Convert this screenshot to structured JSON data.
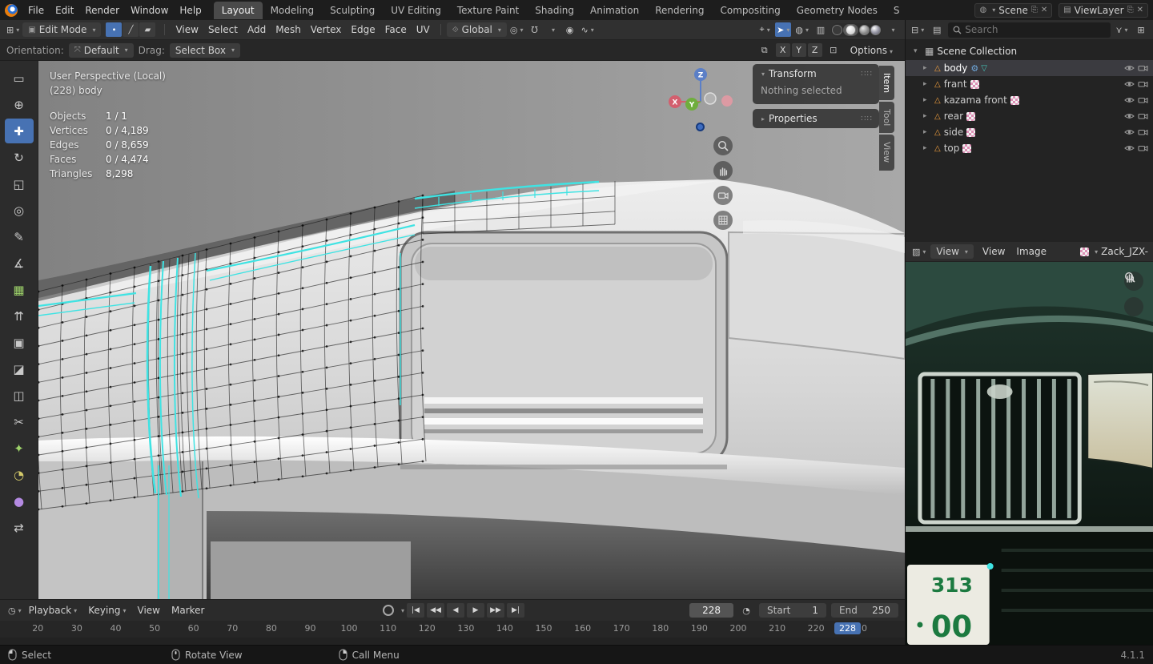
{
  "topbar": {
    "menus": [
      "File",
      "Edit",
      "Render",
      "Window",
      "Help"
    ],
    "tabs": [
      {
        "label": "Layout",
        "active": true
      },
      {
        "label": "Modeling"
      },
      {
        "label": "Sculpting"
      },
      {
        "label": "UV Editing"
      },
      {
        "label": "Texture Paint"
      },
      {
        "label": "Shading"
      },
      {
        "label": "Animation"
      },
      {
        "label": "Rendering"
      },
      {
        "label": "Compositing"
      },
      {
        "label": "Geometry Nodes"
      },
      {
        "label": "S"
      }
    ],
    "scene_name": "Scene",
    "view_layer_name": "ViewLayer"
  },
  "viewport_header": {
    "mode_label": "Edit Mode",
    "menus": [
      "View",
      "Select",
      "Add",
      "Mesh",
      "Vertex",
      "Edge",
      "Face",
      "UV"
    ],
    "orientation_label": "Global"
  },
  "tool_settings": {
    "orientation_label": "Orientation:",
    "orientation_value": "Default",
    "drag_label": "Drag:",
    "drag_value": "Select Box",
    "axis_toggles": [
      "X",
      "Y",
      "Z"
    ],
    "options_label": "Options"
  },
  "toolbar_tools": [
    {
      "name": "tool-select-box-button",
      "icon": "▭"
    },
    {
      "name": "tool-cursor-button",
      "icon": "⊕"
    },
    {
      "name": "tool-move-button",
      "icon": "✚",
      "active": true
    },
    {
      "name": "tool-rotate-button",
      "icon": "↻"
    },
    {
      "name": "tool-scale-button",
      "icon": "◱"
    },
    {
      "name": "tool-transform-button",
      "icon": "◎"
    },
    {
      "name": "tool-annotate-button",
      "icon": "✎"
    },
    {
      "name": "tool-measure-button",
      "icon": "∡"
    },
    {
      "name": "tool-add-cube-button",
      "icon": "▦",
      "color": "#9ed36a"
    },
    {
      "name": "tool-extrude-button",
      "icon": "⇈"
    },
    {
      "name": "tool-inset-faces-button",
      "icon": "▣"
    },
    {
      "name": "tool-bevel-button",
      "icon": "◪"
    },
    {
      "name": "tool-loop-cut-button",
      "icon": "◫"
    },
    {
      "name": "tool-knife-button",
      "icon": "✂"
    },
    {
      "name": "tool-poly-build-button",
      "icon": "✦",
      "color": "#9ed36a"
    },
    {
      "name": "tool-spin-button",
      "icon": "◔",
      "color": "#d3c96a"
    },
    {
      "name": "tool-smooth-button",
      "icon": "●",
      "color": "#b48ae2"
    },
    {
      "name": "tool-edge-slide-button",
      "icon": "⇄"
    }
  ],
  "viewport": {
    "view_label": "User Perspective (Local)",
    "object_label": "(228) body",
    "stats": [
      {
        "label": "Objects",
        "value": "1 / 1"
      },
      {
        "label": "Vertices",
        "value": "0 / 4,189"
      },
      {
        "label": "Edges",
        "value": "0 / 8,659"
      },
      {
        "label": "Faces",
        "value": "0 / 4,474"
      },
      {
        "label": "Triangles",
        "value": "8,298"
      }
    ],
    "gizmo": {
      "x": "X",
      "y": "Y",
      "z": "Z"
    }
  },
  "npanel": {
    "transform_title": "Transform",
    "empty_message": "Nothing selected",
    "properties_title": "Properties",
    "tabs": [
      {
        "label": "Item",
        "active": true
      },
      {
        "label": "Tool"
      },
      {
        "label": "View"
      }
    ]
  },
  "outliner": {
    "search_placeholder": "Search",
    "root_label": "Scene Collection",
    "items": [
      {
        "label": "body",
        "active": true,
        "kind": "mod"
      },
      {
        "label": "frant",
        "kind": "image"
      },
      {
        "label": "kazama front",
        "kind": "image"
      },
      {
        "label": "rear",
        "kind": "image"
      },
      {
        "label": "side",
        "kind": "image"
      },
      {
        "label": "top",
        "kind": "image"
      }
    ]
  },
  "image_editor": {
    "display_mode": "View",
    "menus": [
      "View",
      "Image"
    ],
    "image_name": "Zack_JZX-",
    "plate_top": "313",
    "plate_bottom": "00"
  },
  "timeline": {
    "popovers": [
      "Playback",
      "Keying"
    ],
    "menus": [
      "View",
      "Marker"
    ],
    "transport": [
      {
        "name": "jump-start-button",
        "icon": "|◀"
      },
      {
        "name": "prev-keyframe-button",
        "icon": "◀◀"
      },
      {
        "name": "play-reverse-button",
        "icon": "◀"
      },
      {
        "name": "play-button",
        "icon": "▶"
      },
      {
        "name": "next-keyframe-button",
        "icon": "▶▶"
      },
      {
        "name": "jump-end-button",
        "icon": "▶|"
      }
    ],
    "current_frame": "228",
    "start_label": "Start",
    "start_value": "1",
    "end_label": "End",
    "end_value": "250",
    "ruler": [
      "20",
      "30",
      "40",
      "50",
      "60",
      "70",
      "80",
      "90",
      "100",
      "110",
      "120",
      "130",
      "140",
      "150",
      "160",
      "170",
      "180",
      "190",
      "200",
      "210",
      "220"
    ],
    "playhead_frame": "228",
    "partial_tick": "0"
  },
  "statusbar": {
    "hints": [
      {
        "label": "Select"
      },
      {
        "label": "Rotate View"
      },
      {
        "label": "Call Menu"
      }
    ],
    "version": "4.1.1"
  },
  "colors": {
    "accent_blue": "#4772b3",
    "selection_cyan": "#3fe3e3",
    "mesh_orange": "#ef9d3e"
  }
}
